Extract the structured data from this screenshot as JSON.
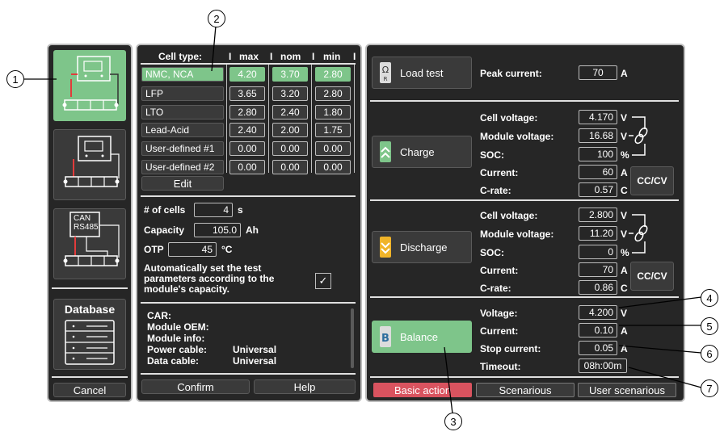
{
  "callouts": [
    "1",
    "2",
    "3",
    "4",
    "5",
    "6",
    "7"
  ],
  "sidebar": {
    "config_label_line1": "CAN",
    "config_label_line2": "RS485",
    "database_label": "Database",
    "cancel_label": "Cancel"
  },
  "cells": {
    "header": {
      "type": "Cell type:",
      "sep": "I",
      "max": "max",
      "nom": "nom",
      "min": "min"
    },
    "rows": [
      {
        "name": "NMC, NCA",
        "max": "4.20",
        "nom": "3.70",
        "min": "2.80"
      },
      {
        "name": "LFP",
        "max": "3.65",
        "nom": "3.20",
        "min": "2.80"
      },
      {
        "name": "LTO",
        "max": "2.80",
        "nom": "2.40",
        "min": "1.80"
      },
      {
        "name": "Lead-Acid",
        "max": "2.40",
        "nom": "2.00",
        "min": "1.75"
      },
      {
        "name": "User-defined #1",
        "max": "0.00",
        "nom": "0.00",
        "min": "0.00"
      },
      {
        "name": "User-defined #2",
        "max": "0.00",
        "nom": "0.00",
        "min": "0.00"
      }
    ],
    "edit_label": "Edit"
  },
  "module": {
    "cells_label": "# of cells",
    "cells_value": "4",
    "cells_unit": "s",
    "capacity_label": "Capacity",
    "capacity_value": "105.0",
    "capacity_unit": "Ah",
    "otp_label": "OTP",
    "otp_value": "45",
    "otp_unit": "°C",
    "auto_text": "Automatically set the test parameters according to the module's capacity.",
    "auto_check": "✓"
  },
  "info": {
    "rows": [
      {
        "label": "CAR:",
        "value": ""
      },
      {
        "label": "Module OEM:",
        "value": ""
      },
      {
        "label": "Module info:",
        "value": ""
      },
      {
        "label": "Power cable:",
        "value": "Universal"
      },
      {
        "label": "Data cable:",
        "value": "Universal"
      }
    ]
  },
  "footer_mid": {
    "confirm": "Confirm",
    "help": "Help"
  },
  "load": {
    "button": "Load test",
    "peak_label": "Peak current:",
    "peak_value": "70",
    "peak_unit": "A"
  },
  "charge": {
    "button": "Charge",
    "cell_v_label": "Cell voltage:",
    "cell_v": "4.170",
    "cell_v_unit": "V",
    "mod_v_label": "Module voltage:",
    "mod_v": "16.68",
    "mod_v_unit": "V",
    "soc_label": "SOC:",
    "soc": "100",
    "soc_unit": "%",
    "cur_label": "Current:",
    "cur": "60",
    "cur_unit": "A",
    "crate_label": "C-rate:",
    "crate": "0.57",
    "crate_unit": "C",
    "mode": "CC/CV"
  },
  "discharge": {
    "button": "Discharge",
    "cell_v_label": "Cell voltage:",
    "cell_v": "2.800",
    "cell_v_unit": "V",
    "mod_v_label": "Module voltage:",
    "mod_v": "11.20",
    "mod_v_unit": "V",
    "soc_label": "SOC:",
    "soc": "0",
    "soc_unit": "%",
    "cur_label": "Current:",
    "cur": "70",
    "cur_unit": "A",
    "crate_label": "C-rate:",
    "crate": "0.86",
    "crate_unit": "C",
    "mode": "CC/CV"
  },
  "balance": {
    "button": "Balance",
    "v_label": "Voltage:",
    "v": "4.200",
    "v_unit": "V",
    "cur_label": "Current:",
    "cur": "0.10",
    "cur_unit": "A",
    "stop_label": "Stop current:",
    "stop": "0.05",
    "stop_unit": "A",
    "timeout_label": "Timeout:",
    "timeout": "08h:00m"
  },
  "tabs": {
    "basic": "Basic action",
    "scen": "Scenarious",
    "user": "User scenarious"
  },
  "colors": {
    "panel": "#262626",
    "accent_green": "#7ec58a",
    "active_tab": "#d9535f"
  }
}
